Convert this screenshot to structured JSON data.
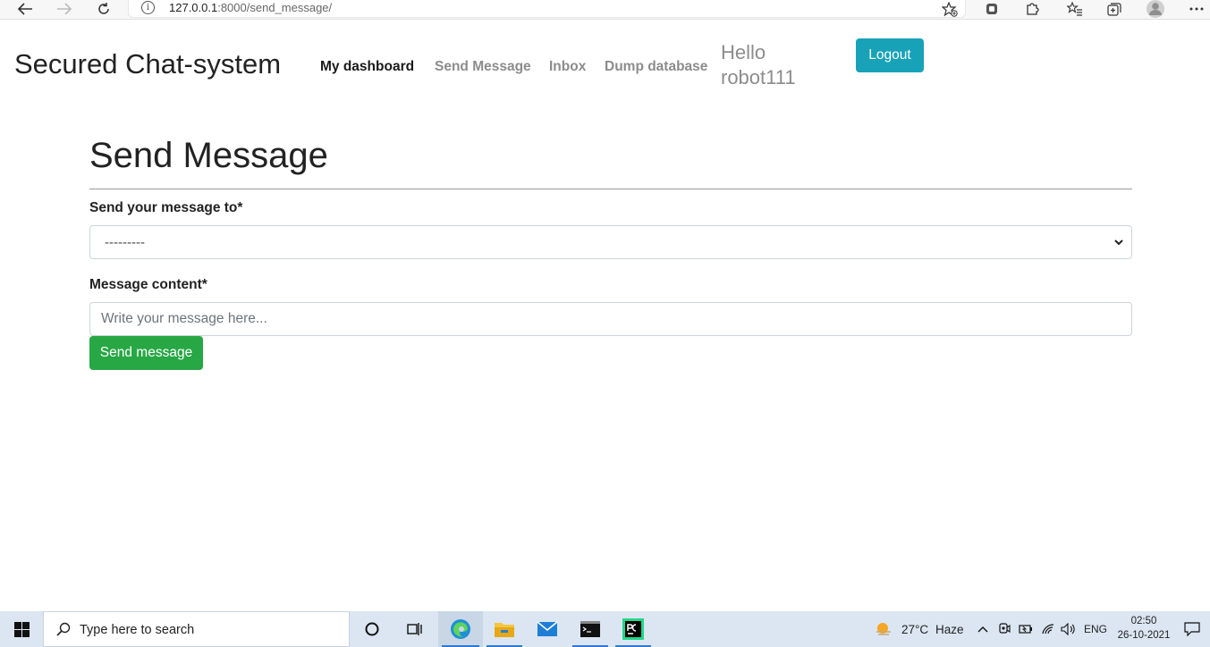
{
  "browser": {
    "url_host": "127.0.0.1",
    "url_rest": ":8000/send_message/",
    "info_glyph": "i"
  },
  "navbar": {
    "brand": "Secured Chat-system",
    "links": [
      "My dashboard",
      "Send Message",
      "Inbox",
      "Dump database"
    ],
    "greeting_line1": "Hello",
    "greeting_line2": "robot111",
    "logout_label": "Logout"
  },
  "form": {
    "title": "Send Message",
    "recipient_label": "Send your message to*",
    "recipient_selected": "---------",
    "content_label": "Message content*",
    "content_placeholder": "Write your message here...",
    "submit_label": "Send message"
  },
  "taskbar": {
    "search_placeholder": "Type here to search",
    "weather_temp": "27°C",
    "weather_desc": "Haze",
    "language": "ENG",
    "time": "02:50",
    "date": "26-10-2021"
  },
  "colors": {
    "logout_button": "#17a2b8",
    "send_button": "#28a745",
    "taskbar": "#dbe6f2"
  },
  "icons": [
    "back-arrow-icon",
    "forward-arrow-icon",
    "refresh-icon",
    "info-icon",
    "favorite-add-icon",
    "collections-icon",
    "extensions-icon",
    "favorites-icon",
    "tab-actions-icon",
    "profile-icon",
    "more-icon",
    "chevron-down-icon",
    "windows-start-icon",
    "search-icon",
    "cortana-icon",
    "task-view-icon",
    "edge-icon",
    "file-explorer-icon",
    "mail-icon",
    "terminal-icon",
    "pycharm-icon",
    "weather-icon",
    "chevron-up-icon",
    "meet-icon",
    "battery-icon",
    "wifi-icon",
    "volume-icon",
    "notification-icon"
  ]
}
